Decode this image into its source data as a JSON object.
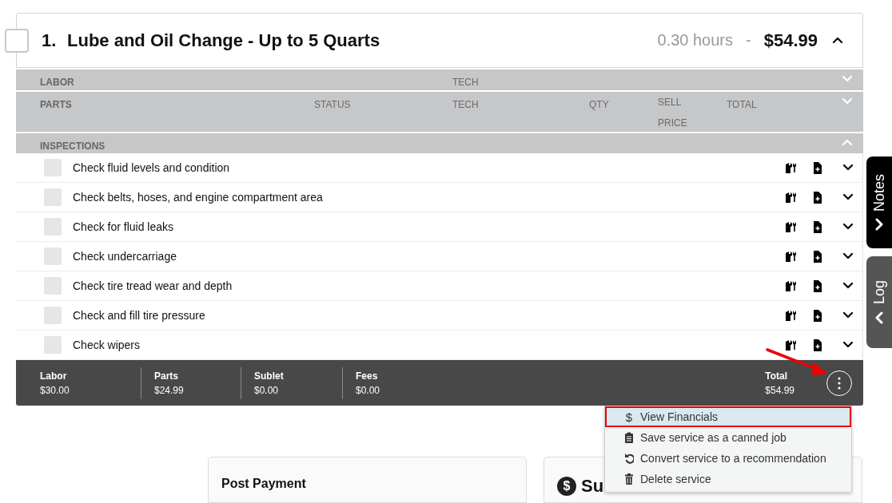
{
  "service": {
    "number": "1.",
    "title": "Lube and Oil Change - Up to 5 Quarts",
    "hours": "0.30 hours",
    "separator": "-",
    "price": "$54.99",
    "checked": false,
    "expanded": true
  },
  "sections": [
    {
      "kind": "labor",
      "columns": [
        "LABOR",
        "TECH"
      ],
      "expanded": false
    },
    {
      "kind": "parts",
      "columns": [
        "PARTS",
        "STATUS",
        "TECH",
        "QTY",
        "SELL PRICE",
        "TOTAL"
      ],
      "expanded": false
    },
    {
      "kind": "inspections",
      "columns": [
        "INSPECTIONS"
      ],
      "expanded": true
    }
  ],
  "inspections": [
    {
      "label": "Check fluid levels and condition",
      "checked": false,
      "expanded": false
    },
    {
      "label": "Check belts, hoses, and engine compartment area",
      "checked": false,
      "expanded": false
    },
    {
      "label": "Check for fluid leaks",
      "checked": false,
      "expanded": false
    },
    {
      "label": "Check undercarriage",
      "checked": false,
      "expanded": false
    },
    {
      "label": "Check tire tread wear and depth",
      "checked": false,
      "expanded": false
    },
    {
      "label": "Check and fill tire pressure",
      "checked": false,
      "expanded": false
    },
    {
      "label": "Check wipers",
      "checked": false,
      "expanded": false
    }
  ],
  "totals": [
    {
      "label": "Labor",
      "value": "$30.00"
    },
    {
      "label": "Parts",
      "value": "$24.99"
    },
    {
      "label": "Sublet",
      "value": "$0.00"
    },
    {
      "label": "Fees",
      "value": "$0.00"
    }
  ],
  "total": {
    "label": "Total",
    "value": "$54.99"
  },
  "menu": {
    "open": true,
    "items": [
      {
        "kind": "dollar",
        "glyph": "$",
        "label": "View Financials",
        "highlighted": true
      },
      {
        "kind": "clipboard",
        "label": "Save service as a canned job",
        "highlighted": false
      },
      {
        "kind": "undo",
        "label": "Convert service to a recommendation",
        "highlighted": false
      },
      {
        "kind": "trash",
        "label": "Delete service",
        "highlighted": false
      }
    ]
  },
  "annotation_arrow": true,
  "panels": [
    {
      "kind": "plain",
      "title": "Post Payment"
    },
    {
      "kind": "money",
      "glyph": "$",
      "title": "Su"
    }
  ],
  "side_tabs": [
    {
      "label": "Notes",
      "selected": true
    },
    {
      "label": "Log",
      "selected": false
    }
  ]
}
